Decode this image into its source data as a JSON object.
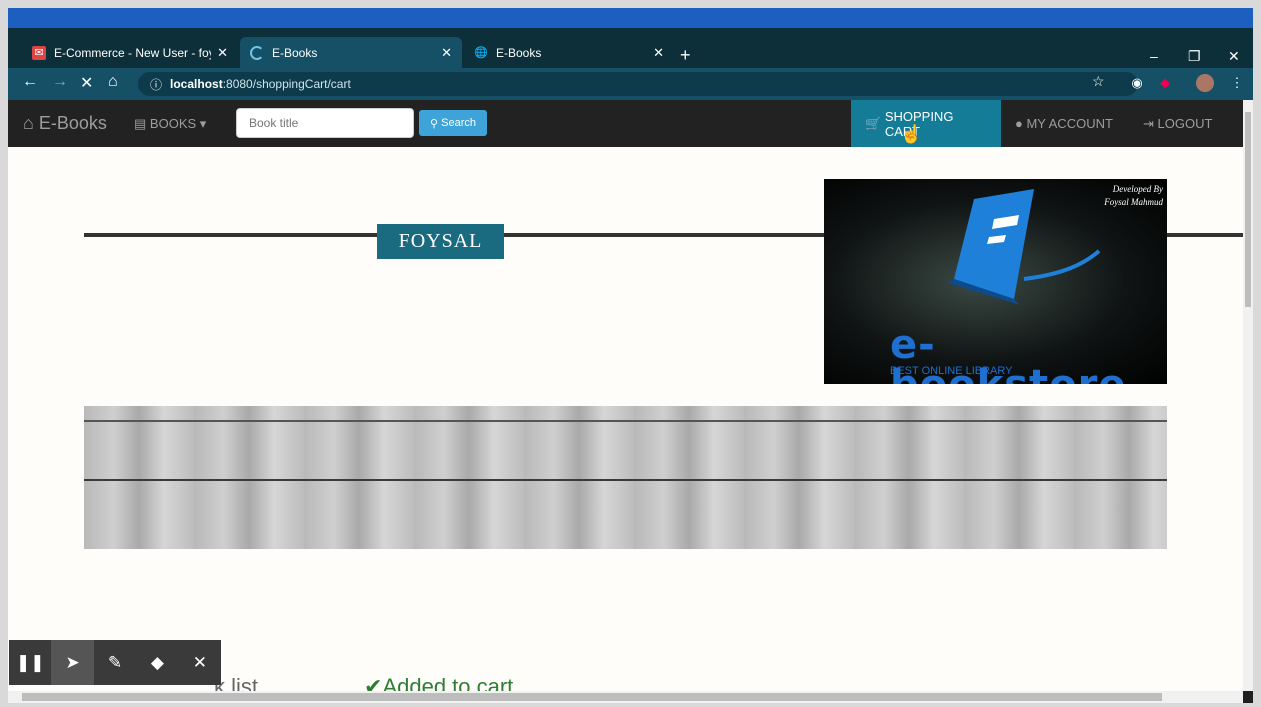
{
  "tabs": [
    {
      "favicon": "mail-icon",
      "title": "E-Commerce - New User - foysal",
      "active": false
    },
    {
      "favicon": "loading-icon",
      "title": "E-Books",
      "active": true
    },
    {
      "favicon": "globe-icon",
      "title": "E-Books",
      "active": false
    }
  ],
  "address": {
    "host": "localhost",
    "path": ":8080/shoppingCart/cart"
  },
  "nav": {
    "brand": "E-Books",
    "books": "BOOKS",
    "search_placeholder": "Book title",
    "search_button": "Search",
    "shopping_cart": "SHOPPING CART",
    "my_account": "MY ACCOUNT",
    "logout": "LOGOUT"
  },
  "hero": {
    "name": "FOYSAL",
    "logo_developed": "Developed By",
    "logo_signature": "Foysal Mahmud",
    "logo_brand": "e-bookstore",
    "logo_sub": "BEST ONLINE LIBRARY"
  },
  "bottom": {
    "left_partial": "k list",
    "added": "Added to cart"
  },
  "colors": {
    "accent": "#157c98",
    "badge": "#1a6b80",
    "success": "#2e7d32"
  }
}
